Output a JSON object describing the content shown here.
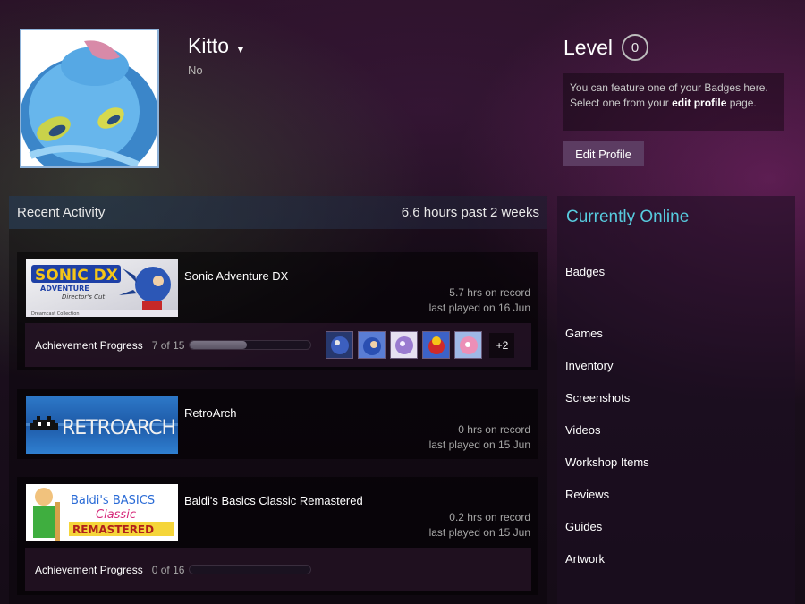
{
  "profile": {
    "name": "Kitto",
    "subtitle": "No"
  },
  "level": {
    "label": "Level",
    "value": "0"
  },
  "badge_box": {
    "line1": "You can feature one of your Badges here.",
    "line2_prefix": "Select one from your ",
    "line2_link": "edit profile",
    "line2_suffix": " page."
  },
  "edit_profile_label": "Edit Profile",
  "recent_activity": {
    "title": "Recent Activity",
    "summary": "6.6 hours past 2 weeks",
    "games": [
      {
        "name": "Sonic Adventure DX",
        "hours": "5.7 hrs on record",
        "last_played": "last played on 16 Jun",
        "achievement_label": "Achievement Progress",
        "achievement_count": "7 of 15",
        "achievement_progress": 0.47,
        "more_achievements": "+2",
        "capsule_title": "SONIC DX",
        "capsule_sub1": "ADVENTURE",
        "capsule_sub2": "Director's Cut",
        "capsule_footer": "Dreamcast Collection"
      },
      {
        "name": "RetroArch",
        "hours": "0 hrs on record",
        "last_played": "last played on 15 Jun",
        "capsule_title": "RETROARCH"
      },
      {
        "name": "Baldi's Basics Classic Remastered",
        "hours": "0.2 hrs on record",
        "last_played": "last played on 15 Jun",
        "achievement_label": "Achievement Progress",
        "achievement_count": "0 of 16",
        "achievement_progress": 0,
        "capsule_line1": "Baldi's BASICS",
        "capsule_line2": "Classic",
        "capsule_line3": "REMASTERED"
      }
    ]
  },
  "sidebar": {
    "status": "Currently Online",
    "links": [
      "Badges",
      "Games",
      "Inventory",
      "Screenshots",
      "Videos",
      "Workshop Items",
      "Reviews",
      "Guides",
      "Artwork"
    ]
  },
  "colors": {
    "online": "#57cbde",
    "edit_button": "#5c3c62",
    "avatar_border": "#8fb3d9"
  }
}
